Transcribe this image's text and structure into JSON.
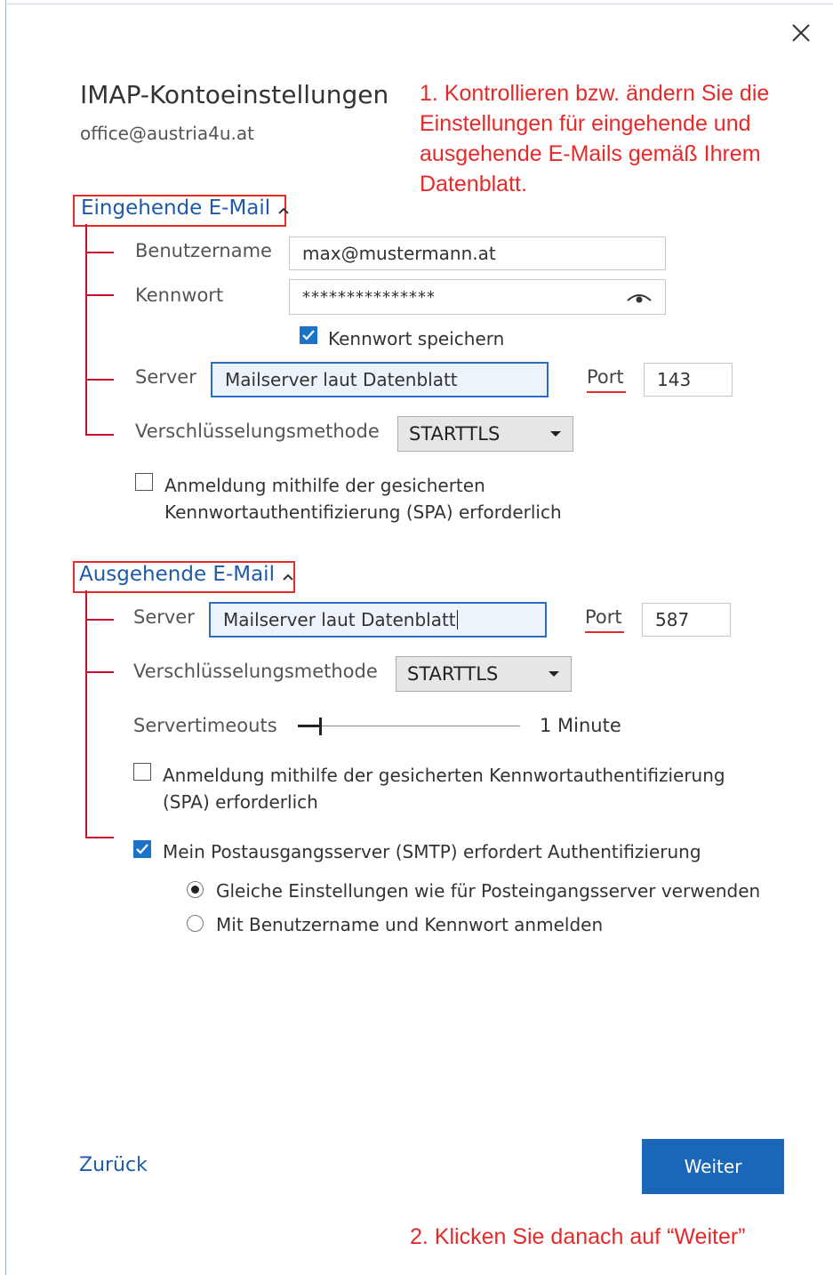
{
  "dialog": {
    "title": "IMAP-Kontoeinstellungen",
    "account_email": "office@austria4u.at"
  },
  "annotations": {
    "note_1": "1. Kontrollieren bzw. ändern Sie die Einstellungen für eingehende und ausgehende E-Mails gemäß Ihrem Datenblatt.",
    "note_2": "2. Klicken Sie danach auf “Weiter”"
  },
  "incoming": {
    "header": "Eingehende E-Mail",
    "username_label": "Benutzername",
    "username_value": "max@mustermann.at",
    "password_label": "Kennwort",
    "password_value": "***************",
    "save_password_label": "Kennwort speichern",
    "save_password_checked": true,
    "server_label": "Server",
    "server_value": "Mailserver laut Datenblatt",
    "port_label": "Port",
    "port_value": "143",
    "encryption_label": "Verschlüsselungsmethode",
    "encryption_value": "STARTTLS",
    "spa_label_line1": "Anmeldung mithilfe der gesicherten",
    "spa_label_line2": "Kennwortauthentifizierung (SPA) erforderlich",
    "spa_checked": false
  },
  "outgoing": {
    "header": "Ausgehende E-Mail",
    "server_label": "Server",
    "server_value": "Mailserver laut Datenblatt",
    "port_label": "Port",
    "port_value": "587",
    "encryption_label": "Verschlüsselungsmethode",
    "encryption_value": "STARTTLS",
    "timeout_label": "Servertimeouts",
    "timeout_value": "1 Minute",
    "timeout_level": 0.1,
    "spa_label_line1": "Anmeldung mithilfe der gesicherten Kennwortauthentifizierung",
    "spa_label_line2": "(SPA) erforderlich",
    "spa_checked": false,
    "smtp_auth_label": "Mein Postausgangsserver (SMTP) erfordert Authentifizierung",
    "smtp_auth_checked": true,
    "radio_same_label": "Gleiche Einstellungen wie für Posteingangsserver verwenden",
    "radio_login_label": "Mit Benutzername und Kennwort anmelden",
    "selected_radio": "same"
  },
  "footer": {
    "back_label": "Zurück",
    "next_label": "Weiter"
  },
  "colors": {
    "accent": "#1a67b7",
    "link": "#1e5aa8",
    "annotation_red": "#e52a2a"
  }
}
